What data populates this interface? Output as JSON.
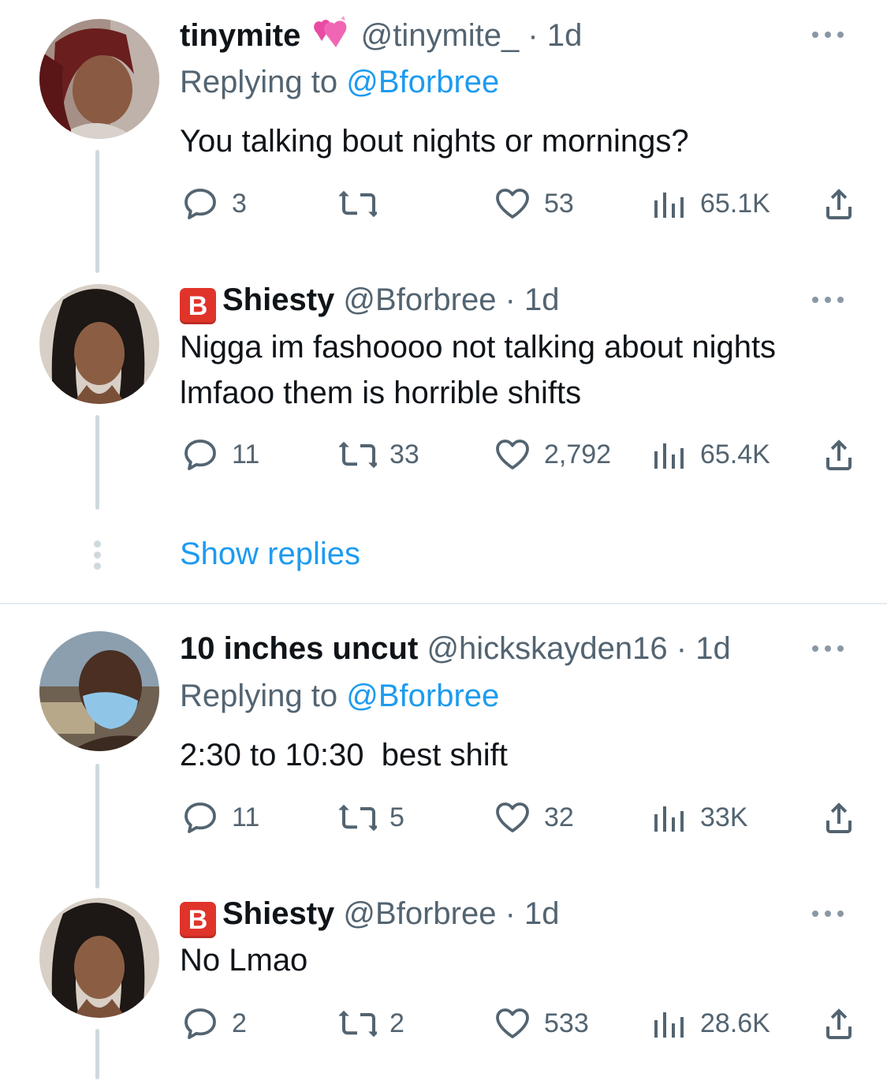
{
  "tweets": [
    {
      "name": "tinymite",
      "name_emoji": "💕",
      "handle": "@tinymite_",
      "time": "· 1d",
      "replying_prefix": "Replying to ",
      "replying_to": "@Bforbree",
      "text": "You talking bout nights or mornings?",
      "replies": "3",
      "retweets": "",
      "likes": "53",
      "views": "65.1K"
    },
    {
      "badge": "B",
      "name": "Shiesty",
      "handle": "@Bforbree",
      "time": "· 1d",
      "text": "Nigga im fashoooo not talking about nights lmfaoo them is horrible shifts",
      "replies": "11",
      "retweets": "33",
      "likes": "2,792",
      "views": "65.4K"
    },
    {
      "name": "10 inches uncut",
      "handle": "@hickskayden16",
      "time": "· 1d",
      "replying_prefix": "Replying to ",
      "replying_to": "@Bforbree",
      "text": "2:30 to 10:30  best shift",
      "replies": "11",
      "retweets": "5",
      "likes": "32",
      "views": "33K"
    },
    {
      "badge": "B",
      "name": "Shiesty",
      "handle": "@Bforbree",
      "time": "· 1d",
      "text": "No Lmao",
      "replies": "2",
      "retweets": "2",
      "likes": "533",
      "views": "28.6K"
    }
  ],
  "show_replies": "Show replies",
  "colors": {
    "link": "#1d9bf0",
    "muted": "#536471",
    "thread_line": "#cfd9de",
    "badge_red": "#e0342b"
  }
}
